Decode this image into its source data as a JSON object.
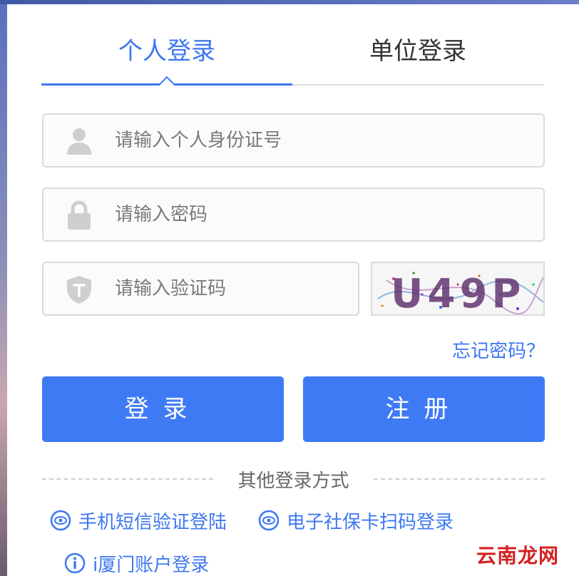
{
  "tabs": {
    "personal": "个人登录",
    "unit": "单位登录"
  },
  "fields": {
    "id_placeholder": "请输入个人身份证号",
    "password_placeholder": "请输入密码",
    "code_placeholder": "请输入验证码"
  },
  "captcha": {
    "text": "U49P"
  },
  "links": {
    "forgot": "忘记密码？"
  },
  "buttons": {
    "login": "登录",
    "register": "注册"
  },
  "other": {
    "divider": "其他登录方式",
    "sms": "手机短信验证登陆",
    "social_card": "电子社保卡扫码登录",
    "xiamen": "i厦门账户登录"
  },
  "watermark": "云南龙网",
  "icons": {
    "id": "user-icon",
    "password": "lock-icon",
    "code": "shield-t-icon",
    "sms": "eye-circle-icon",
    "social_card": "eye-circle-icon",
    "xiamen": "info-circle-icon"
  },
  "colors": {
    "accent": "#3d78f0",
    "button": "#3f7af5"
  }
}
